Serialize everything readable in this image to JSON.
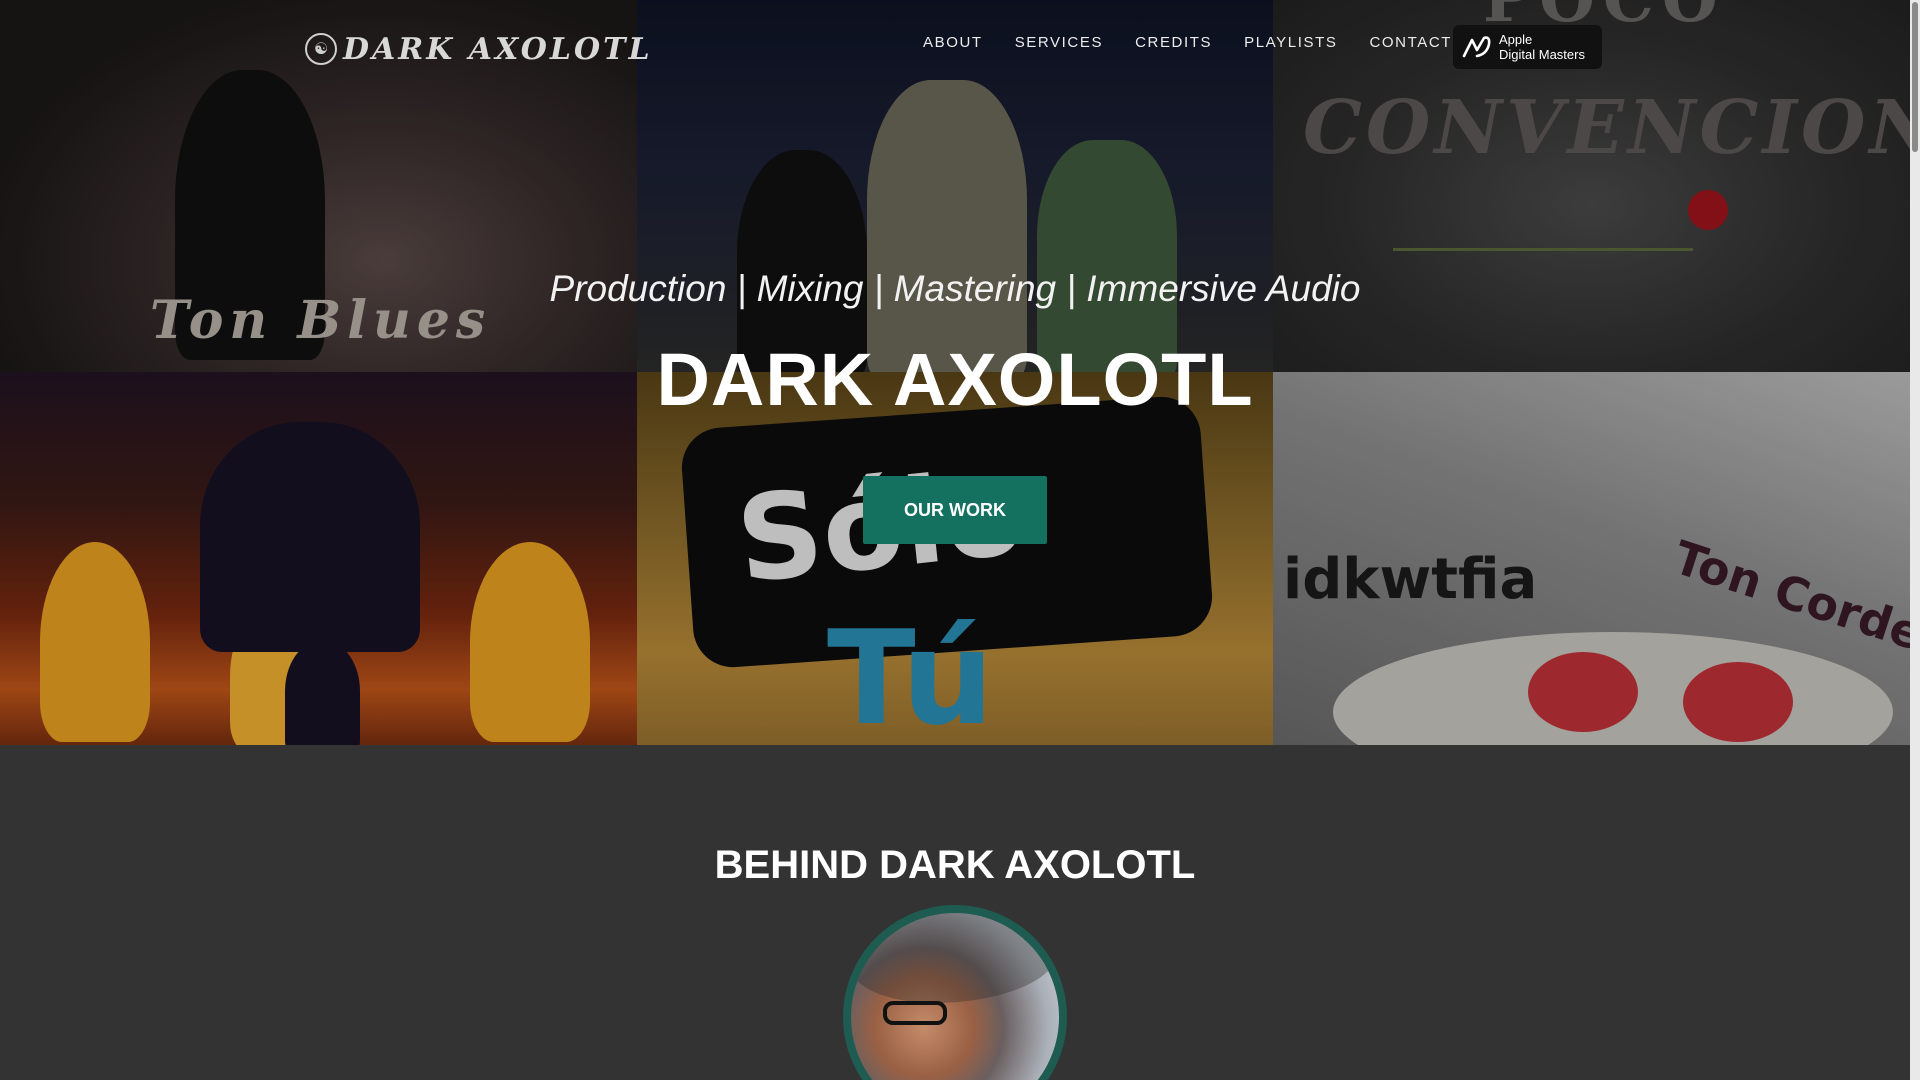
{
  "header": {
    "logo_text": "DARK AXOLOTL",
    "logo_icon": "axolotl-emblem-icon",
    "nav": [
      {
        "label": "ABOUT"
      },
      {
        "label": "SERVICES"
      },
      {
        "label": "CREDITS"
      },
      {
        "label": "PLAYLISTS"
      },
      {
        "label": "CONTACT"
      }
    ],
    "badge": {
      "line1": "Apple",
      "line2": "Digital Masters",
      "icon": "apple-digital-masters-icon"
    }
  },
  "hero": {
    "tagline": "Production | Mixing | Mastering | Immersive Audio",
    "title": "DARK AXOLOTL",
    "cta_label": "OUR WORK",
    "tiles": [
      {
        "caption": "Ton Blues"
      },
      {
        "caption": ""
      },
      {
        "caption": "CONVENCIONAL",
        "caption_top": "POCO"
      },
      {
        "caption": ""
      },
      {
        "caption": "Sólo",
        "caption2": "Tú"
      },
      {
        "caption": "idkwtfia",
        "caption2": "Ton Cordero"
      }
    ]
  },
  "about": {
    "title": "BEHIND DARK AXOLOTL"
  },
  "colors": {
    "page_bg": "#333333",
    "accent": "#15715f",
    "avatar_ring": "#1e5b50"
  }
}
